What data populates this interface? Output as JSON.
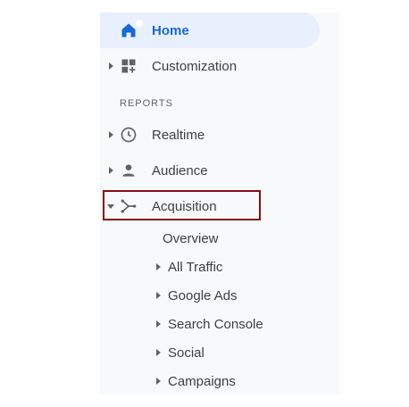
{
  "nav": {
    "home_label": "Home",
    "customization_label": "Customization",
    "reports_header": "REPORTS",
    "realtime_label": "Realtime",
    "audience_label": "Audience",
    "acquisition_label": "Acquisition"
  },
  "acquisition_sub": {
    "overview": "Overview",
    "all_traffic": "All Traffic",
    "google_ads": "Google Ads",
    "search_console": "Search Console",
    "social": "Social",
    "campaigns": "Campaigns"
  },
  "icons": {
    "home": "home-icon",
    "customization": "dashboard-add-icon",
    "realtime": "clock-icon",
    "audience": "person-icon",
    "acquisition": "acquisition-branch-icon"
  },
  "colors": {
    "active_bg": "#e8f0fe",
    "active_text": "#1967d2",
    "highlight_border": "#8b0c12"
  }
}
